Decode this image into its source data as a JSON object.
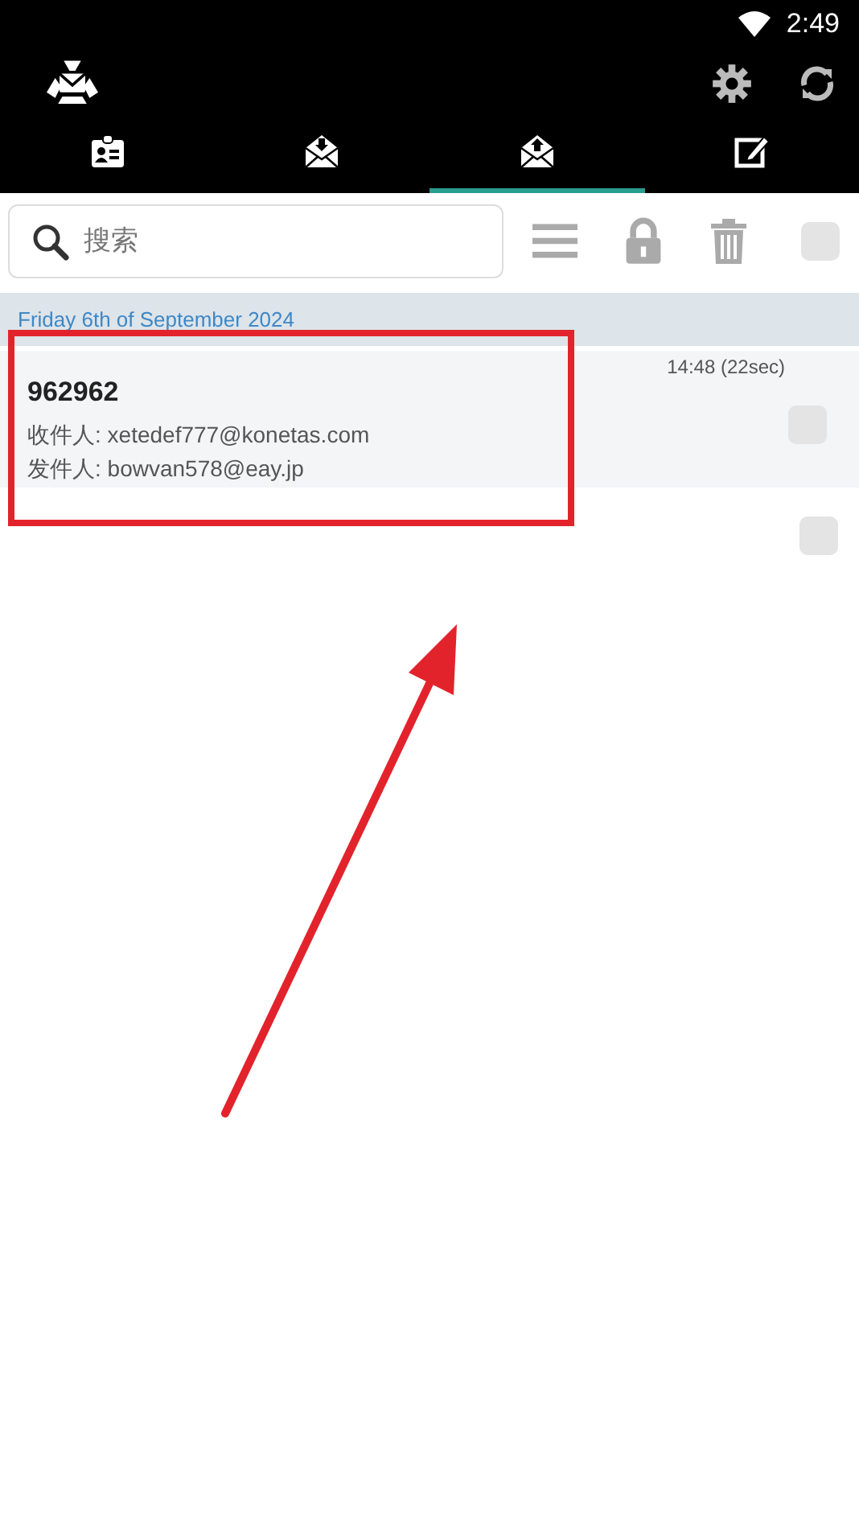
{
  "status_bar": {
    "time": "2:49"
  },
  "tabs": [
    {
      "kind": "contacts",
      "selected": false
    },
    {
      "kind": "inbox",
      "selected": false
    },
    {
      "kind": "outbox",
      "selected": true
    },
    {
      "kind": "compose",
      "selected": false
    }
  ],
  "toolbar": {
    "search": {
      "placeholder": "搜索"
    },
    "select_all": {
      "checked": false
    }
  },
  "date_header": "Friday 6th of September 2024",
  "messages": [
    {
      "kind": "message",
      "subject": "962962",
      "recipient": "收件人: xetedef777@konetas.com",
      "sender": "发件人: bowvan578@eay.jp",
      "time": "14:48 (22sec)",
      "checked": false,
      "highlighted": true
    },
    {
      "kind": "empty",
      "checked": false
    }
  ]
}
